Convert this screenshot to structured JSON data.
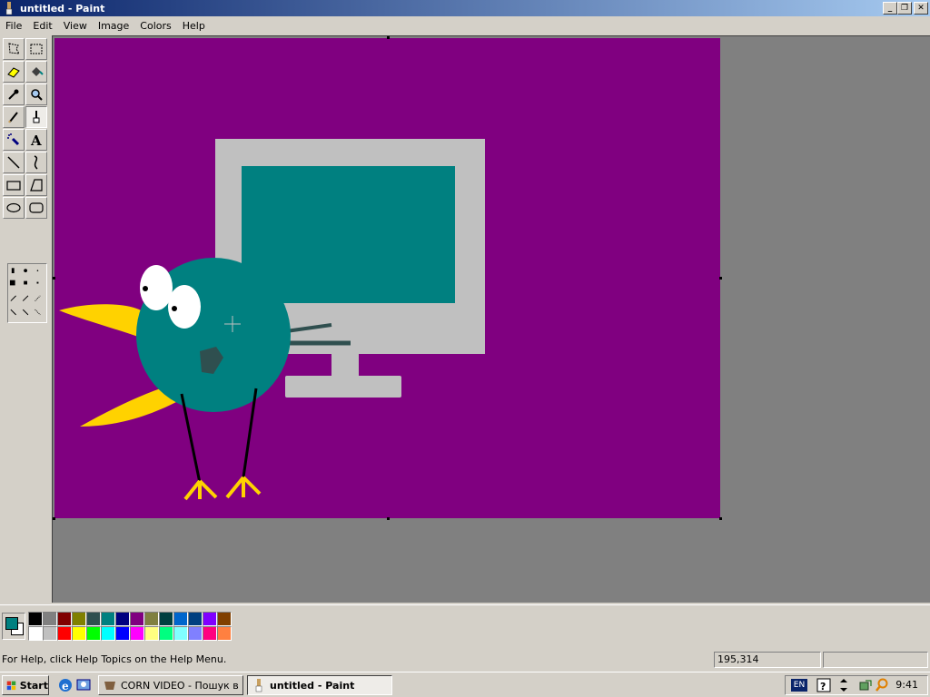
{
  "window": {
    "title": "untitled - Paint"
  },
  "menu": [
    "File",
    "Edit",
    "View",
    "Image",
    "Colors",
    "Help"
  ],
  "tools": [
    "free-form-select",
    "select",
    "eraser",
    "fill-with-color",
    "pick-color",
    "magnifier",
    "pencil",
    "brush",
    "airbrush",
    "text",
    "line",
    "curve",
    "rectangle",
    "polygon",
    "ellipse",
    "rounded-rectangle"
  ],
  "canvas": {
    "background": "#800080"
  },
  "colors": {
    "foreground": "#008080",
    "background": "#ffffff",
    "palette_row1": [
      "#000000",
      "#808080",
      "#800000",
      "#808000",
      "#2f4f4f",
      "#008080",
      "#000080",
      "#800080",
      "#808040",
      "#004040",
      "#0066cc",
      "#004080",
      "#8000ff",
      "#804000"
    ],
    "palette_row2": [
      "#ffffff",
      "#c0c0c0",
      "#ff0000",
      "#ffff00",
      "#00ff00",
      "#00ffff",
      "#0000ff",
      "#ff00ff",
      "#ffff80",
      "#00ff80",
      "#80ffff",
      "#8080ff",
      "#ff0080",
      "#ff8040"
    ]
  },
  "status": {
    "help": "For Help, click Help Topics on the Help Menu.",
    "coords": "195,314",
    "size": ""
  },
  "taskbar": {
    "start": "Start",
    "tasks": [
      {
        "label": "CORN VIDEO - Пошук в ...",
        "active": false
      },
      {
        "label": "untitled - Paint",
        "active": true
      }
    ],
    "lang": "EN",
    "clock": "9:41"
  }
}
